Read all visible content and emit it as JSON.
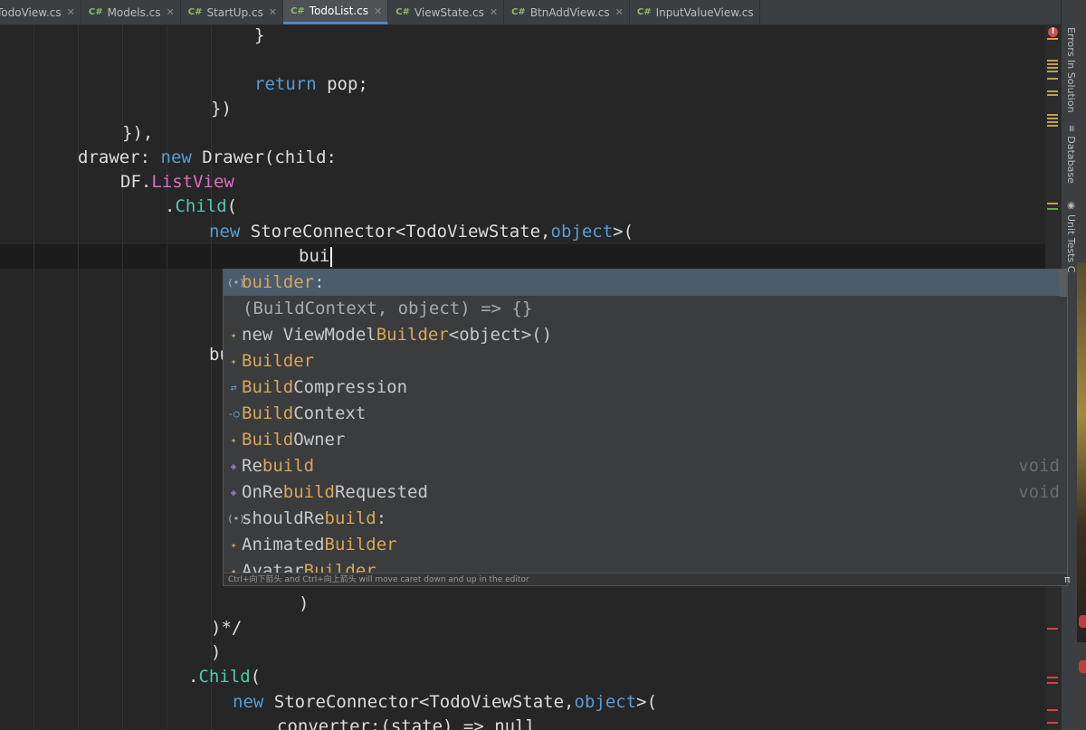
{
  "tabs": [
    {
      "icon": "",
      "label": "TodoView.cs",
      "close": "✕",
      "active": false
    },
    {
      "icon": "C#",
      "label": "Models.cs",
      "close": "✕",
      "active": false
    },
    {
      "icon": "C#",
      "label": "StartUp.cs",
      "close": "✕",
      "active": false
    },
    {
      "icon": "C#",
      "label": "TodoList.cs",
      "close": "✕",
      "active": true
    },
    {
      "icon": "C#",
      "label": "ViewState.cs",
      "close": "✕",
      "active": false
    },
    {
      "icon": "C#",
      "label": "BtnAddView.cs",
      "close": "✕",
      "active": false
    },
    {
      "icon": "C#",
      "label": "InputValueView.cs",
      "close": "",
      "active": false
    }
  ],
  "code": {
    "l1": "}",
    "l2_kw": "return",
    "l2_rest": " pop;",
    "l3": "})",
    "l4": "}),",
    "l5_a": "drawer: ",
    "l5_kw": "new",
    "l5_b": " Drawer(child:",
    "l6_a": "DF.",
    "l6_ty": "ListView",
    "l7_a": ".",
    "l7_mt": "Child",
    "l7_b": "(",
    "l8_kw": "new",
    "l8_b": " StoreConnector<TodoViewState,",
    "l8_kw2": "object",
    "l8_c": ">(",
    "l9": "bui",
    "l10": "bu",
    "l11": ")",
    "l12": ")*/",
    "l13": ")",
    "l14_a": ".",
    "l14_mt": "Child",
    "l14_b": "(",
    "l15_kw": "new",
    "l15_b": " StoreConnector<TodoViewState,",
    "l15_kw2": "object",
    "l15_c": ">(",
    "l16": "converter:(state) => null"
  },
  "completion": {
    "items": [
      {
        "icon": "(•)",
        "pre": "",
        "hl": "builder",
        "post": ":",
        "ret": ""
      },
      {
        "icon": "",
        "hint": "(BuildContext, object) => {}",
        "ret": ""
      },
      {
        "icon": "✦",
        "pre": "new ViewModel",
        "hl": "Builder",
        "post": "<object>()",
        "ret": ""
      },
      {
        "icon": "✦",
        "pre": "",
        "hl": "Builder",
        "post": "",
        "ret": ""
      },
      {
        "icon": "⇄",
        "pre": "",
        "hl": "Build",
        "post": "Compression",
        "ret": ""
      },
      {
        "icon": "-○",
        "pre": "",
        "hl": "Build",
        "post": "Context",
        "ret": ""
      },
      {
        "icon": "✦",
        "pre": "",
        "hl": "Build",
        "post": "Owner",
        "ret": ""
      },
      {
        "icon": "◈",
        "pre": "Re",
        "hl": "build",
        "post": "",
        "ret": "void"
      },
      {
        "icon": "◈",
        "pre": "OnRe",
        "hl": "build",
        "post": "Requested",
        "ret": "void"
      },
      {
        "icon": "(•)",
        "pre": "shouldRe",
        "hl": "build",
        "post": ":",
        "ret": ""
      },
      {
        "icon": "✦",
        "pre": "Animated",
        "hl": "Builder",
        "post": "",
        "ret": ""
      },
      {
        "icon": "✦",
        "pre": "Avatar",
        "hl": "Builder",
        "post": "",
        "ret": ""
      }
    ],
    "footer": "Ctrl+向下箭头 and Ctrl+向上箭头 will move caret down and up in the editor"
  },
  "sidebar": {
    "errors": "Errors In Solution",
    "database": "Database",
    "unit_tests": "Unit Tests C"
  },
  "pi_glyph": "π",
  "error_icon": "!"
}
